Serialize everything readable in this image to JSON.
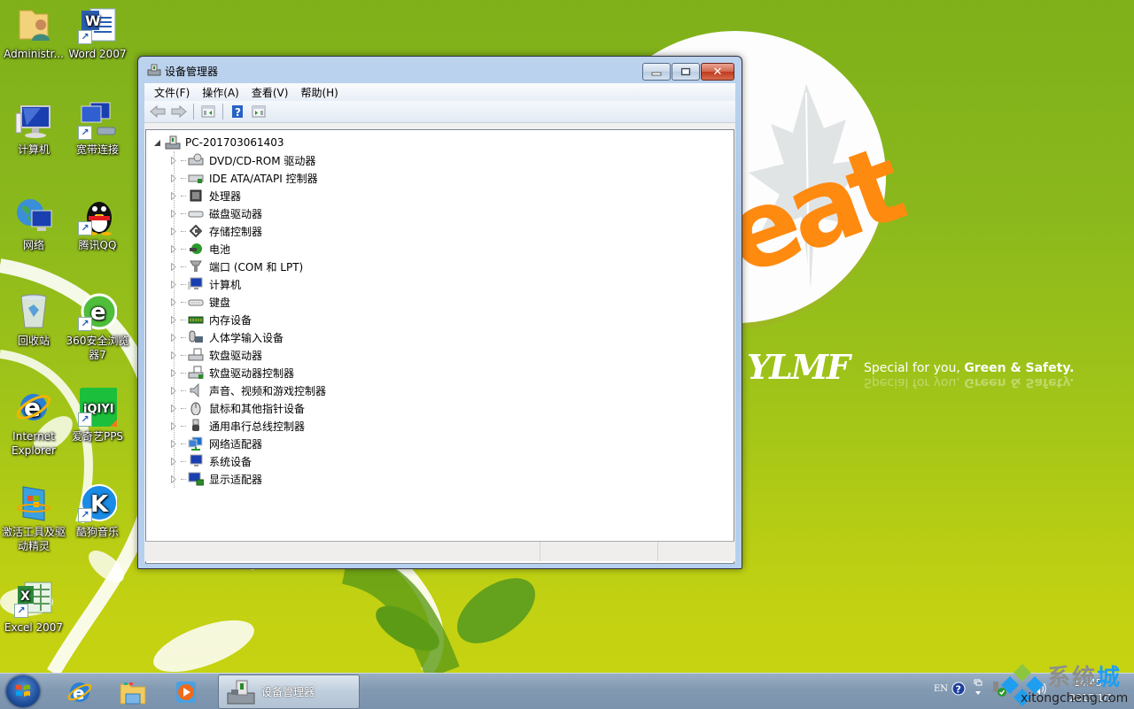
{
  "wallpaper": {
    "brand_text": "YLMF",
    "slogan_normal": "Special for you, ",
    "slogan_bold": "Green & Safety.",
    "orange_text": "eat"
  },
  "desktop_icons": [
    {
      "label": "Administr...",
      "icon": "user-folder-icon"
    },
    {
      "label": "Word 2007",
      "icon": "word-icon",
      "shortcut": true
    },
    {
      "label": "计算机",
      "icon": "computer-icon"
    },
    {
      "label": "宽带连接",
      "icon": "broadband-connection-icon",
      "shortcut": true
    },
    {
      "label": "网络",
      "icon": "network-icon"
    },
    {
      "label": "腾讯QQ",
      "icon": "qq-icon",
      "shortcut": true
    },
    {
      "label": "回收站",
      "icon": "recycle-bin-icon"
    },
    {
      "label": "360安全浏览器7",
      "icon": "360-browser-icon",
      "shortcut": true
    },
    {
      "label": "Internet Explorer",
      "icon": "ie-icon"
    },
    {
      "label": "爱奇艺PPS",
      "icon": "iqiyi-icon",
      "shortcut": true
    },
    {
      "label": "激活工具及驱动精灵",
      "icon": "activation-tool-icon"
    },
    {
      "label": "酷狗音乐",
      "icon": "kugou-icon",
      "shortcut": true
    },
    {
      "label": "Excel 2007",
      "icon": "excel-icon",
      "shortcut": true
    }
  ],
  "window": {
    "title": "设备管理器",
    "menu": [
      "文件(F)",
      "操作(A)",
      "查看(V)",
      "帮助(H)"
    ],
    "toolbar": [
      "back",
      "forward",
      "show-hide-console-tree",
      "help",
      "show-hide-action-pane"
    ],
    "tree": {
      "root": "PC-201703061403",
      "items": [
        {
          "label": "DVD/CD-ROM 驱动器",
          "icon": "dvd-drive-icon"
        },
        {
          "label": "IDE ATA/ATAPI 控制器",
          "icon": "ide-controller-icon"
        },
        {
          "label": "处理器",
          "icon": "processor-icon"
        },
        {
          "label": "磁盘驱动器",
          "icon": "disk-drive-icon"
        },
        {
          "label": "存储控制器",
          "icon": "storage-controller-icon"
        },
        {
          "label": "电池",
          "icon": "battery-icon"
        },
        {
          "label": "端口 (COM 和 LPT)",
          "icon": "port-icon"
        },
        {
          "label": "计算机",
          "icon": "computer-icon"
        },
        {
          "label": "键盘",
          "icon": "keyboard-icon"
        },
        {
          "label": "内存设备",
          "icon": "memory-icon"
        },
        {
          "label": "人体学输入设备",
          "icon": "hid-icon"
        },
        {
          "label": "软盘驱动器",
          "icon": "floppy-drive-icon"
        },
        {
          "label": "软盘驱动器控制器",
          "icon": "floppy-controller-icon"
        },
        {
          "label": "声音、视频和游戏控制器",
          "icon": "sound-icon"
        },
        {
          "label": "鼠标和其他指针设备",
          "icon": "mouse-icon"
        },
        {
          "label": "通用串行总线控制器",
          "icon": "usb-icon"
        },
        {
          "label": "网络适配器",
          "icon": "network-adapter-icon"
        },
        {
          "label": "系统设备",
          "icon": "system-device-icon"
        },
        {
          "label": "显示适配器",
          "icon": "display-adapter-icon"
        }
      ]
    }
  },
  "taskbar": {
    "pinned": [
      "internet-explorer",
      "windows-explorer",
      "media-player"
    ],
    "active_task": "设备管理器",
    "tray": {
      "language": "EN",
      "time": "14:45",
      "date": "2017/1/1"
    }
  },
  "watermark": {
    "cn_gray": "系统",
    "cn_blue": "城",
    "en": "xitongcheng.com"
  }
}
